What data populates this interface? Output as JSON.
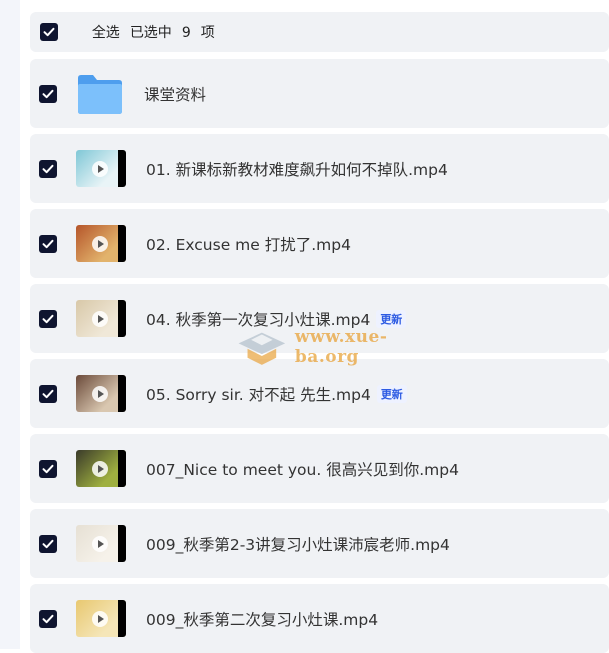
{
  "header": {
    "select_all_label": "全选",
    "selected_prefix": "已选中",
    "selected_count": "9",
    "selected_suffix": "项"
  },
  "files": [
    {
      "name": "课堂资料",
      "type": "folder",
      "badge": ""
    },
    {
      "name": "01. 新课标新教材难度飙升如何不掉队.mp4",
      "type": "video",
      "badge": "",
      "thumb_colors": [
        "#7fc7d6",
        "#e9f4f7"
      ]
    },
    {
      "name": "02. Excuse me 打扰了.mp4",
      "type": "video",
      "badge": "",
      "thumb_colors": [
        "#b5552a",
        "#e2b36c"
      ]
    },
    {
      "name": "04. 秋季第一次复习小灶课.mp4",
      "type": "video",
      "badge": "更新",
      "thumb_colors": [
        "#d8c8a8",
        "#f0e8d8"
      ]
    },
    {
      "name": "05. Sorry sir. 对不起 先生.mp4",
      "type": "video",
      "badge": "更新",
      "thumb_colors": [
        "#6b4a3a",
        "#d9c7b0"
      ]
    },
    {
      "name": "007_Nice to meet you. 很高兴见到你.mp4",
      "type": "video",
      "badge": "",
      "thumb_colors": [
        "#3a3a2a",
        "#9fb040"
      ]
    },
    {
      "name": "009_秋季第2-3讲复习小灶课沛宸老师.mp4",
      "type": "video",
      "badge": "",
      "thumb_colors": [
        "#e6e0d4",
        "#f6f2ea"
      ]
    },
    {
      "name": "009_秋季第二次复习小灶课.mp4",
      "type": "video",
      "badge": "",
      "thumb_colors": [
        "#e8c870",
        "#f5e6b8"
      ]
    }
  ],
  "watermark": {
    "text": "www.xue-ba.org"
  },
  "colors": {
    "checkbox": "#0f1530",
    "row_bg": "#f0f2f5",
    "badge_text": "#2d5be3",
    "folder": "#5aa9f2"
  }
}
